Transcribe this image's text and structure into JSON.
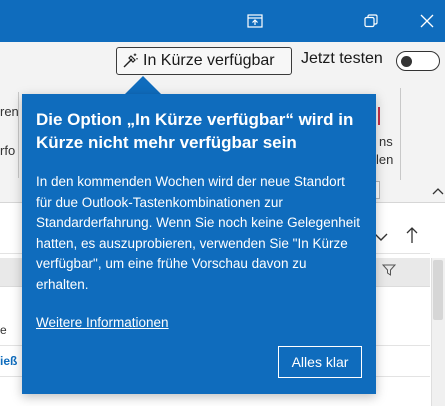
{
  "titlebar": {
    "buttons": [
      "present-icon",
      "restore-icon",
      "close-icon"
    ],
    "color": "#0f6cbd"
  },
  "ribbon": {
    "preview_label": "In Kürze verfügbar",
    "preview_icon": "magic-wand-icon",
    "try_label": "Jetzt testen",
    "toggle_on": false,
    "fragments": {
      "left_1": "ren",
      "left_2": "rfo",
      "right_1": "ns",
      "right_2": "len"
    }
  },
  "list": {
    "sort_icon": "sort-arrow-icon",
    "filter_icon": "filter-icon",
    "row_fragments": [
      "e",
      "ieß"
    ]
  },
  "callout": {
    "title": "Die Option „In Kürze verfügbar“ wird in Kürze nicht mehr verfügbar sein",
    "body": "In den kommenden Wochen wird der neue Standort für due Outlook-Tastenkombinationen zur Standarderfahrung. Wenn Sie noch keine Gelegenheit hatten, es auszuprobieren, verwenden Sie \"In Kürze verfügbar\", um eine frühe Vorschau davon zu erhalten.",
    "link": "Weitere Informationen",
    "button": "Alles klar",
    "color": "#0f6cbd"
  }
}
